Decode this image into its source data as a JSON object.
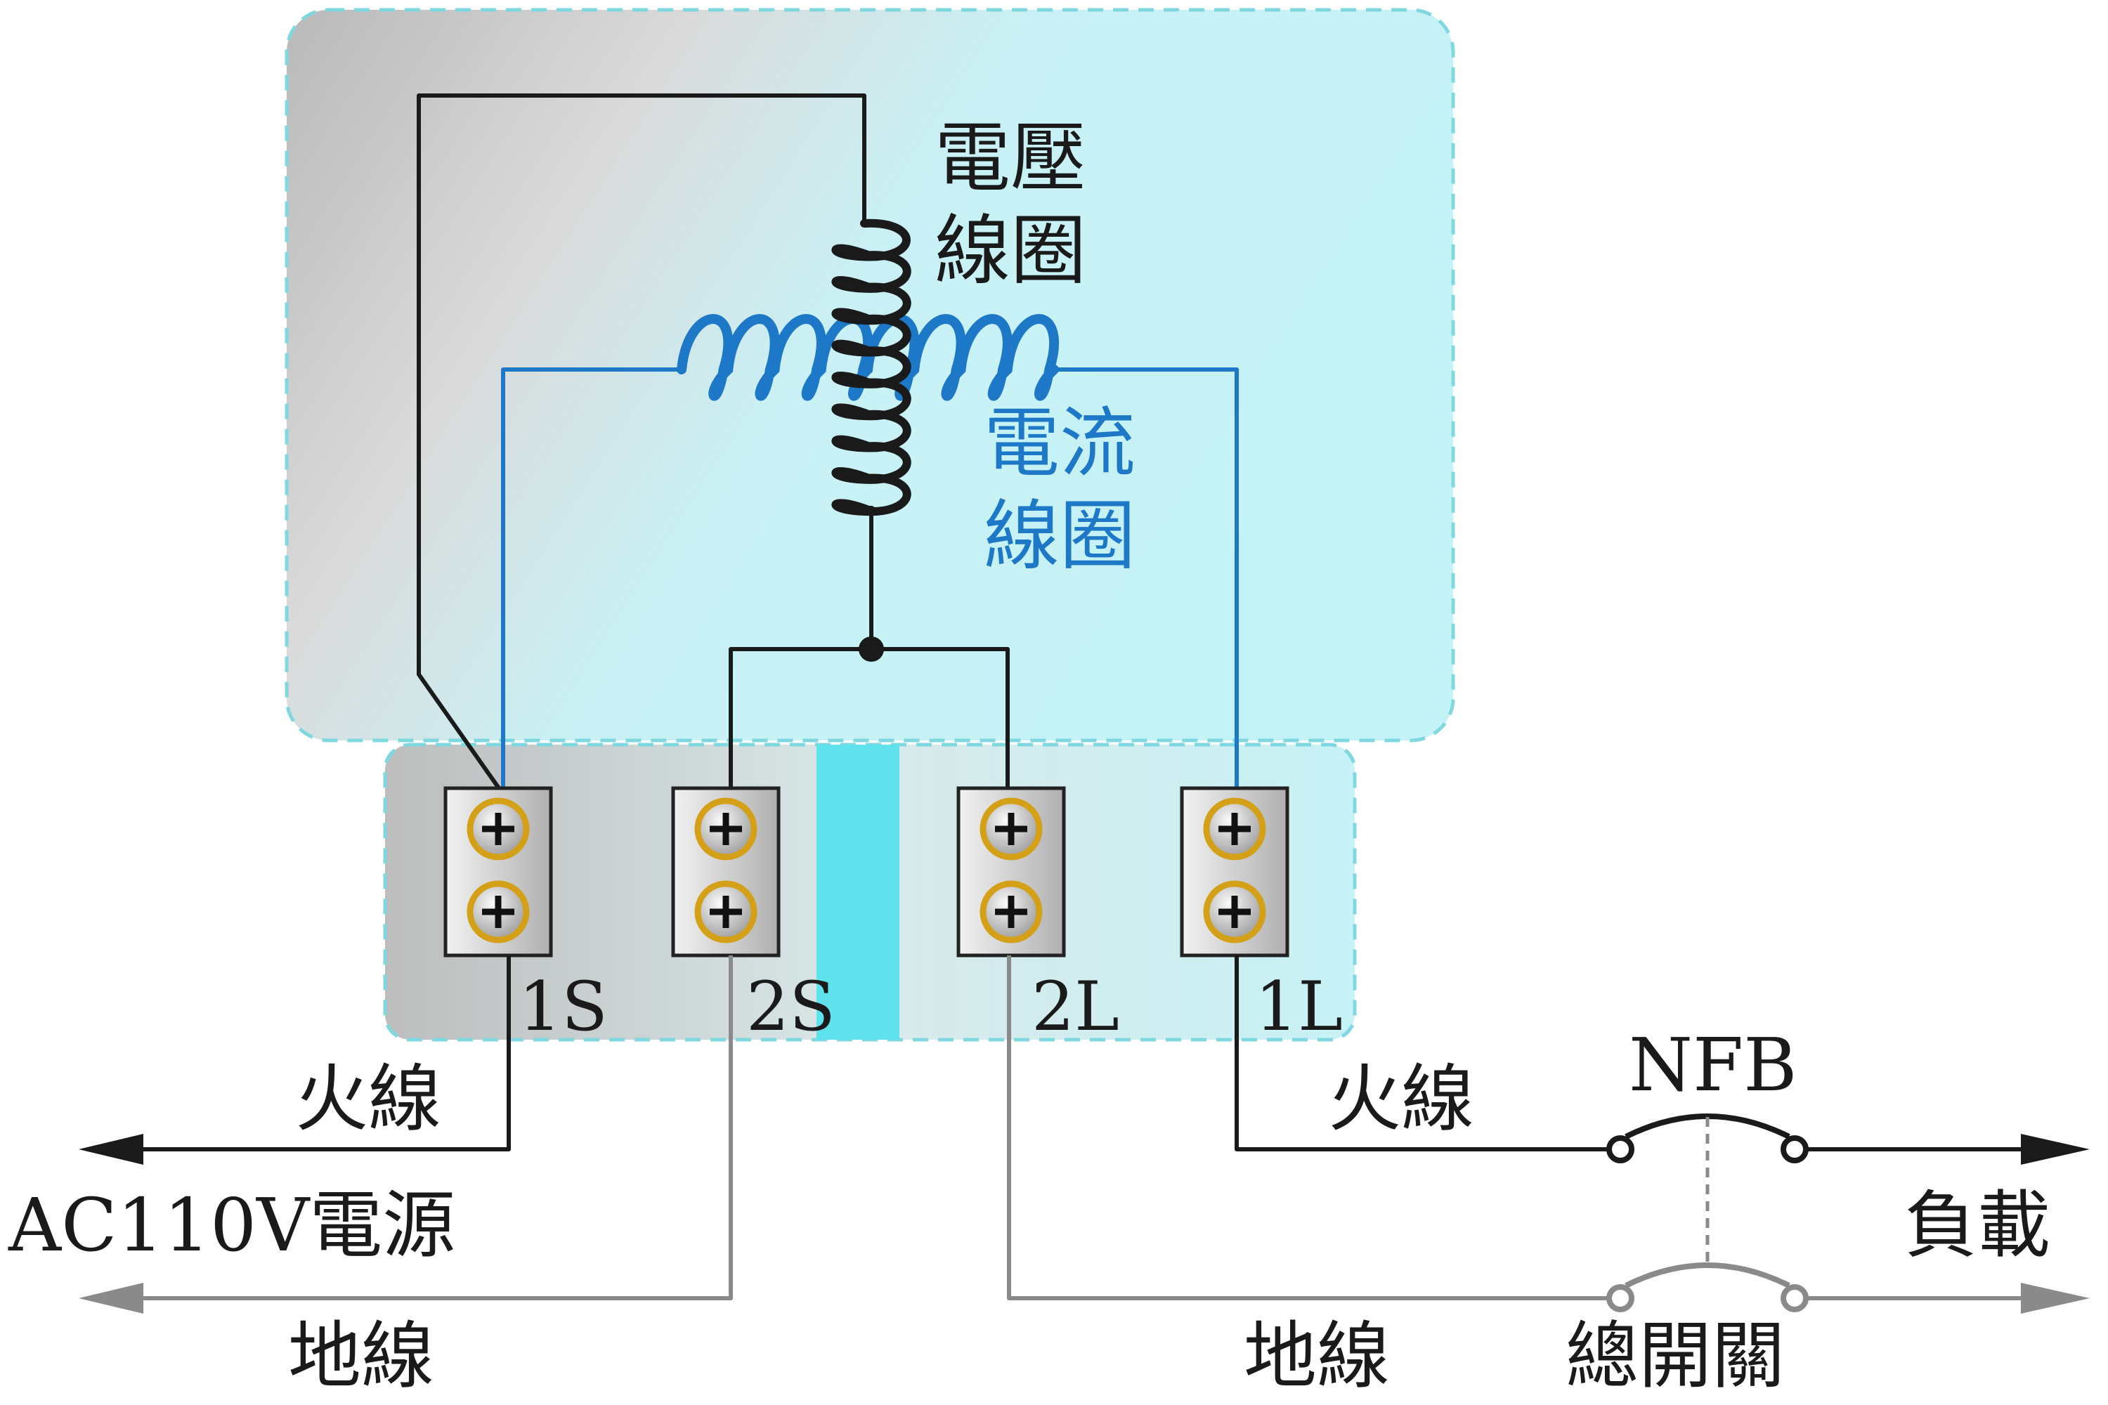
{
  "labels": {
    "voltage_coil": [
      "電壓",
      "線圈"
    ],
    "current_coil": [
      "電流",
      "線圈"
    ],
    "terminals": [
      "1S",
      "2S",
      "2L",
      "1L"
    ],
    "left_live": "火線",
    "left_source": "AC110V電源",
    "left_ground": "地線",
    "right_live": "火線",
    "right_load": "負載",
    "right_ground": "地線",
    "breaker_name": "NFB",
    "breaker_caption": "總開關"
  },
  "colors": {
    "voltage_wire": "#1a1a1a",
    "current_wire": "#1e78c8",
    "ground_wire": "#8a8a8a",
    "housing_top": "#c8eef0",
    "housing_edge": "#7fd8e0",
    "screw_ring": "#d4a017"
  }
}
